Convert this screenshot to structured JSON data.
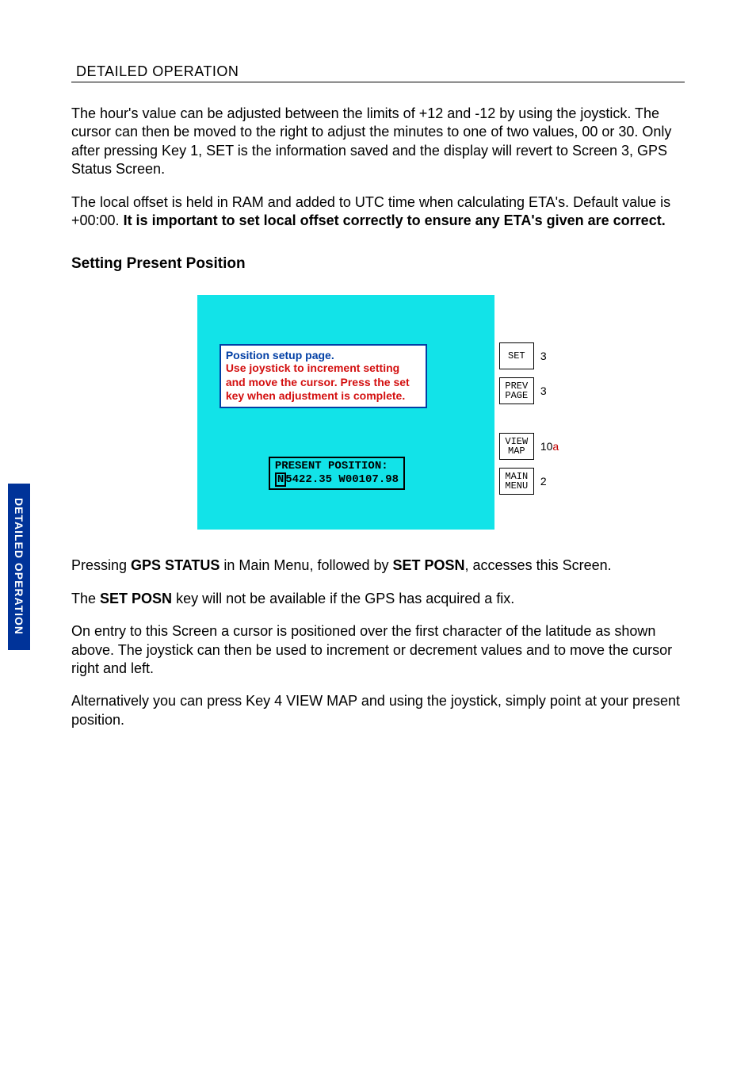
{
  "header": {
    "title": "DETAILED OPERATION"
  },
  "side_tab": "DETAILED OPERATION",
  "paragraphs": {
    "p1": "The hour's value can be adjusted between the limits of +12 and -12 by using the joystick.  The cursor can then be moved to the right to adjust the minutes to one of two values, 00 or 30.  Only after pressing Key 1, SET is the information saved and the display will revert to Screen 3, GPS Status Screen.",
    "p2a": "The local offset is held in RAM and added to UTC time when calculating ETA's.  Default value is +00:00.  ",
    "p2b": "It is important to set local offset correctly to ensure any ETA's given are correct.",
    "heading": "Setting Present Position",
    "p3a": "Pressing ",
    "p3b": "GPS STATUS",
    "p3c": " in Main Menu, followed by ",
    "p3d": "SET POSN",
    "p3e": ", accesses this Screen.",
    "p4a": "The ",
    "p4b": "SET POSN",
    "p4c": " key will not be available if the GPS has acquired a fix.",
    "p5": "On entry to this Screen a cursor is positioned over the first character of the latitude as shown above.  The joystick can then be used to increment or decrement values and to move the cursor right and left.",
    "p6": "Alternatively you can press Key 4 VIEW MAP and using the joystick, simply point at your present position."
  },
  "figure": {
    "help_title": "Position setup page.",
    "help_body": "Use joystick to increment setting and move the cursor. Press the set key when adjustment is complete.",
    "posn_label": "PRESENT POSITION:",
    "posn_cursor_char": "N",
    "posn_rest": "5422.35 W00107.98",
    "keys": [
      {
        "id": "set",
        "lines": [
          "SET"
        ],
        "num": "3",
        "num_suffix": ""
      },
      {
        "id": "prevpage",
        "lines": [
          "PREV",
          "PAGE"
        ],
        "num": "3",
        "num_suffix": ""
      },
      {
        "id": "viewmap",
        "lines": [
          "VIEW",
          "MAP"
        ],
        "num": "10",
        "num_suffix": "a"
      },
      {
        "id": "mainmenu",
        "lines": [
          "MAIN",
          "MENU"
        ],
        "num": "2",
        "num_suffix": ""
      }
    ]
  }
}
